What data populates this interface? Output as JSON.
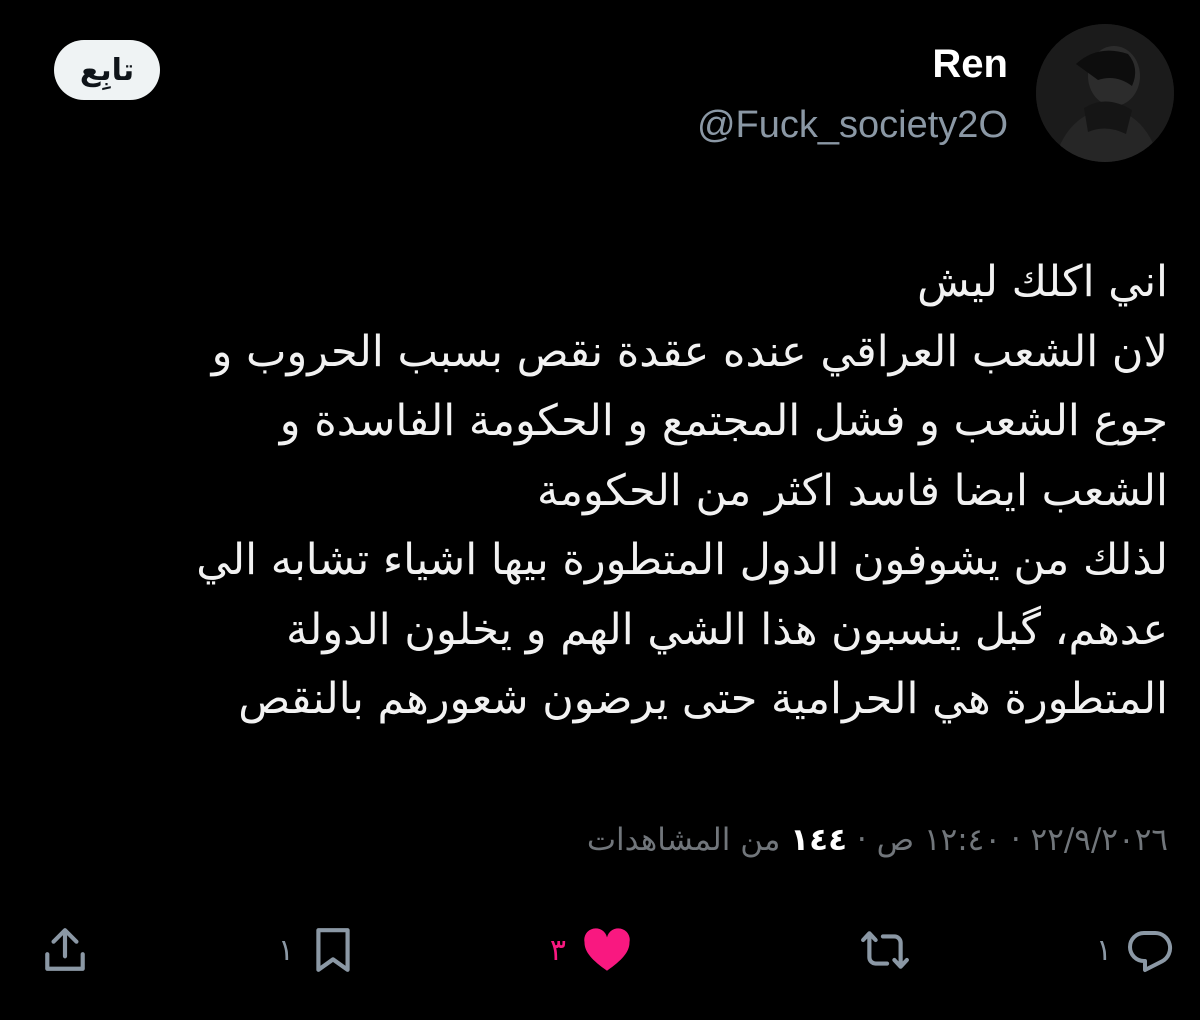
{
  "header": {
    "follow_label": "تابِع",
    "display_name": "Ren",
    "handle": "@Fuck_society2O",
    "avatar_icon": "avatar-photo"
  },
  "tweet": {
    "lines": [
      "اني اكلك ليش",
      "لان الشعب العراقي عنده عقدة نقص بسبب الحروب و",
      "جوع الشعب و فشل المجتمع و الحكومة الفاسدة و",
      "الشعب ايضا فاسد اكثر من الحكومة",
      "لذلك من يشوفون الدول المتطورة بيها اشياء تشابه الي",
      "عدهم، گبل ينسبون هذا الشي الهم و يخلون الدولة",
      "المتطورة هي الحرامية حتى يرضون شعورهم بالنقص"
    ]
  },
  "meta": {
    "date": "٢٢/٩/٢٠٢٦",
    "separator": " · ",
    "time": "١٢:٤٠ ص",
    "views_count": "١٤٤",
    "views_label": " من المشاهدات"
  },
  "actions": {
    "reply": {
      "count": "١",
      "icon": "reply-icon"
    },
    "retweet": {
      "count": "",
      "icon": "retweet-icon"
    },
    "like": {
      "count": "٣",
      "icon": "heart-icon",
      "color": "#f91880"
    },
    "bookmark": {
      "count": "١",
      "icon": "bookmark-icon"
    },
    "share": {
      "count": "",
      "icon": "share-icon"
    }
  },
  "colors": {
    "background": "#000000",
    "text": "#f2f2f2",
    "muted": "#71767b",
    "like": "#f91880",
    "follow_button_bg": "#eff3f4"
  }
}
